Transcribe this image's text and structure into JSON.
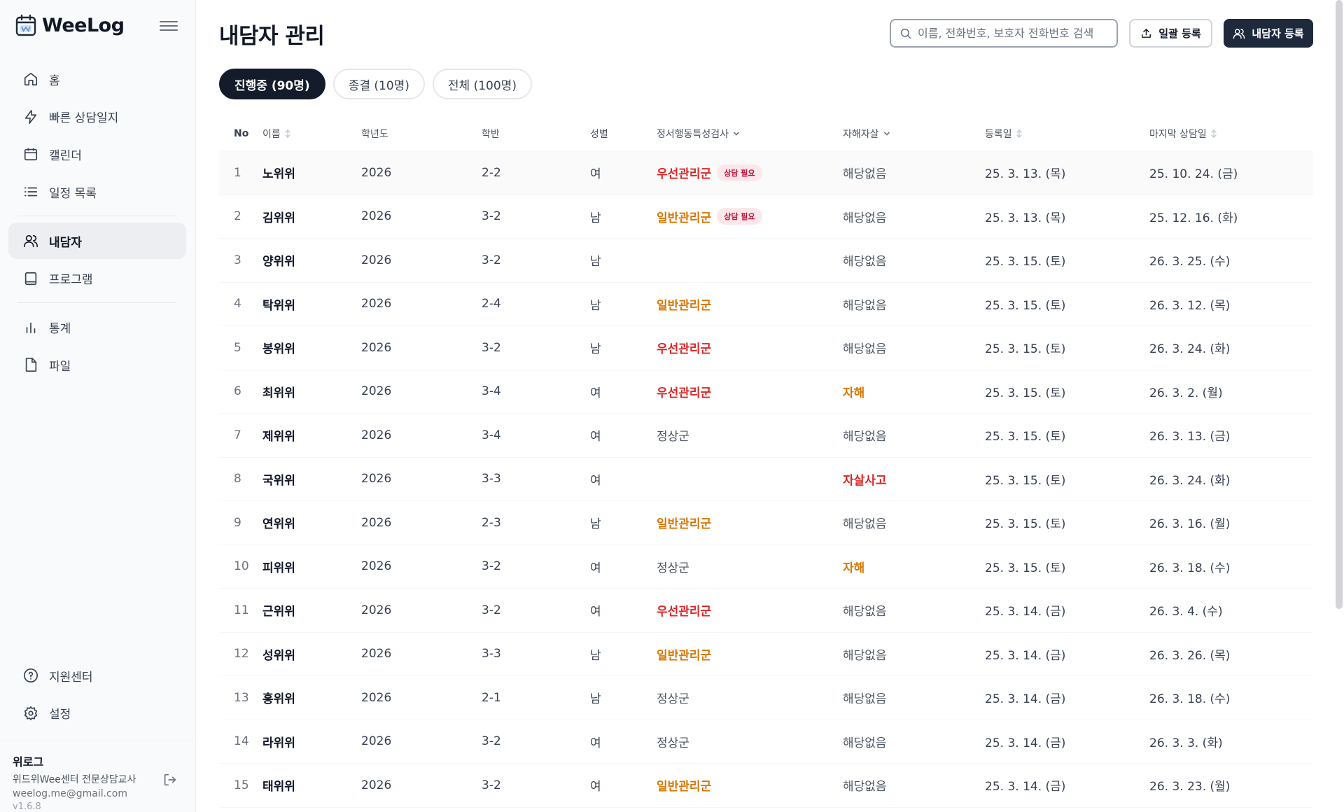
{
  "app": {
    "brand_name": "WeeLog"
  },
  "sidebar": {
    "items": [
      {
        "label": "홈",
        "icon": "home-icon"
      },
      {
        "label": "빠른 상담일지",
        "icon": "lightning-icon"
      },
      {
        "label": "캘린더",
        "icon": "calendar-icon"
      },
      {
        "label": "일정 목록",
        "icon": "list-icon"
      },
      {
        "label": "내담자",
        "icon": "users-icon",
        "active": true
      },
      {
        "label": "프로그램",
        "icon": "book-icon"
      },
      {
        "label": "통계",
        "icon": "bar-chart-icon"
      },
      {
        "label": "파일",
        "icon": "file-icon"
      }
    ],
    "bottom_items": [
      {
        "label": "지원센터",
        "icon": "help-circle-icon"
      },
      {
        "label": "설정",
        "icon": "gear-icon"
      }
    ],
    "user": {
      "name": "위로그",
      "role": "위드위Wee센터 전문상담교사",
      "email": "weelog.me@gmail.com",
      "version": "v1.6.8"
    }
  },
  "header": {
    "title": "내담자 관리",
    "search_placeholder": "이름, 전화번호, 보호자 전화번호 검색",
    "bulk_register_label": "일괄 등록",
    "add_client_label": "내담자 등록"
  },
  "tabs": [
    {
      "label": "진행중 (90명)",
      "active": true
    },
    {
      "label": "종결 (10명)",
      "active": false
    },
    {
      "label": "전체 (100명)",
      "active": false
    }
  ],
  "table": {
    "columns": {
      "no": "No",
      "name": "이름",
      "year": "학년도",
      "class": "학반",
      "sex": "성별",
      "emotion": "정서행동특성검사",
      "self_harm": "자해자살",
      "registered": "등록일",
      "last_session": "마지막 상담일"
    },
    "rows": [
      {
        "no": "1",
        "name": "노위위",
        "year": "2026",
        "class": "2-2",
        "sex": "여",
        "emotion": "우선관리군",
        "emotion_level": "red",
        "badge": "상담 필요",
        "self_harm": "해당없음",
        "self_harm_level": "none",
        "registered": "25. 3. 13. (목)",
        "last_session": "25. 10. 24. (금)"
      },
      {
        "no": "2",
        "name": "김위위",
        "year": "2026",
        "class": "3-2",
        "sex": "남",
        "emotion": "일반관리군",
        "emotion_level": "orange",
        "badge": "상담 필요",
        "self_harm": "해당없음",
        "self_harm_level": "none",
        "registered": "25. 3. 13. (목)",
        "last_session": "25. 12. 16. (화)"
      },
      {
        "no": "3",
        "name": "양위위",
        "year": "2026",
        "class": "3-2",
        "sex": "남",
        "emotion": "",
        "emotion_level": "none",
        "badge": "",
        "self_harm": "해당없음",
        "self_harm_level": "none",
        "registered": "25. 3. 15. (토)",
        "last_session": "26. 3. 25. (수)"
      },
      {
        "no": "4",
        "name": "탁위위",
        "year": "2026",
        "class": "2-4",
        "sex": "남",
        "emotion": "일반관리군",
        "emotion_level": "orange",
        "badge": "",
        "self_harm": "해당없음",
        "self_harm_level": "none",
        "registered": "25. 3. 15. (토)",
        "last_session": "26. 3. 12. (목)"
      },
      {
        "no": "5",
        "name": "봉위위",
        "year": "2026",
        "class": "3-2",
        "sex": "남",
        "emotion": "우선관리군",
        "emotion_level": "red",
        "badge": "",
        "self_harm": "해당없음",
        "self_harm_level": "none",
        "registered": "25. 3. 15. (토)",
        "last_session": "26. 3. 24. (화)"
      },
      {
        "no": "6",
        "name": "최위위",
        "year": "2026",
        "class": "3-4",
        "sex": "여",
        "emotion": "우선관리군",
        "emotion_level": "red",
        "badge": "",
        "self_harm": "자해",
        "self_harm_level": "orange",
        "registered": "25. 3. 15. (토)",
        "last_session": "26. 3. 2. (월)"
      },
      {
        "no": "7",
        "name": "제위위",
        "year": "2026",
        "class": "3-4",
        "sex": "여",
        "emotion": "정상군",
        "emotion_level": "normal",
        "badge": "",
        "self_harm": "해당없음",
        "self_harm_level": "none",
        "registered": "25. 3. 15. (토)",
        "last_session": "26. 3. 13. (금)"
      },
      {
        "no": "8",
        "name": "국위위",
        "year": "2026",
        "class": "3-3",
        "sex": "여",
        "emotion": "",
        "emotion_level": "none",
        "badge": "",
        "self_harm": "자살사고",
        "self_harm_level": "red",
        "registered": "25. 3. 15. (토)",
        "last_session": "26. 3. 24. (화)"
      },
      {
        "no": "9",
        "name": "연위위",
        "year": "2026",
        "class": "2-3",
        "sex": "남",
        "emotion": "일반관리군",
        "emotion_level": "orange",
        "badge": "",
        "self_harm": "해당없음",
        "self_harm_level": "none",
        "registered": "25. 3. 15. (토)",
        "last_session": "26. 3. 16. (월)"
      },
      {
        "no": "10",
        "name": "피위위",
        "year": "2026",
        "class": "3-2",
        "sex": "여",
        "emotion": "정상군",
        "emotion_level": "normal",
        "badge": "",
        "self_harm": "자해",
        "self_harm_level": "orange",
        "registered": "25. 3. 15. (토)",
        "last_session": "26. 3. 18. (수)"
      },
      {
        "no": "11",
        "name": "근위위",
        "year": "2026",
        "class": "3-2",
        "sex": "여",
        "emotion": "우선관리군",
        "emotion_level": "red",
        "badge": "",
        "self_harm": "해당없음",
        "self_harm_level": "none",
        "registered": "25. 3. 14. (금)",
        "last_session": "26. 3. 4. (수)"
      },
      {
        "no": "12",
        "name": "성위위",
        "year": "2026",
        "class": "3-3",
        "sex": "남",
        "emotion": "일반관리군",
        "emotion_level": "orange",
        "badge": "",
        "self_harm": "해당없음",
        "self_harm_level": "none",
        "registered": "25. 3. 14. (금)",
        "last_session": "26. 3. 26. (목)"
      },
      {
        "no": "13",
        "name": "홍위위",
        "year": "2026",
        "class": "2-1",
        "sex": "남",
        "emotion": "정상군",
        "emotion_level": "normal",
        "badge": "",
        "self_harm": "해당없음",
        "self_harm_level": "none",
        "registered": "25. 3. 14. (금)",
        "last_session": "26. 3. 18. (수)"
      },
      {
        "no": "14",
        "name": "라위위",
        "year": "2026",
        "class": "3-2",
        "sex": "여",
        "emotion": "정상군",
        "emotion_level": "normal",
        "badge": "",
        "self_harm": "해당없음",
        "self_harm_level": "none",
        "registered": "25. 3. 14. (금)",
        "last_session": "26. 3. 3. (화)"
      },
      {
        "no": "15",
        "name": "태위위",
        "year": "2026",
        "class": "3-2",
        "sex": "여",
        "emotion": "일반관리군",
        "emotion_level": "orange",
        "badge": "",
        "self_harm": "해당없음",
        "self_harm_level": "none",
        "registered": "25. 3. 14. (금)",
        "last_session": "26. 3. 23. (월)"
      }
    ]
  },
  "colors": {
    "primary": "#1e293b",
    "priority_red": "#dc2626",
    "general_orange": "#d97706",
    "badge_bg": "#fde7ea",
    "badge_text": "#be123c"
  }
}
